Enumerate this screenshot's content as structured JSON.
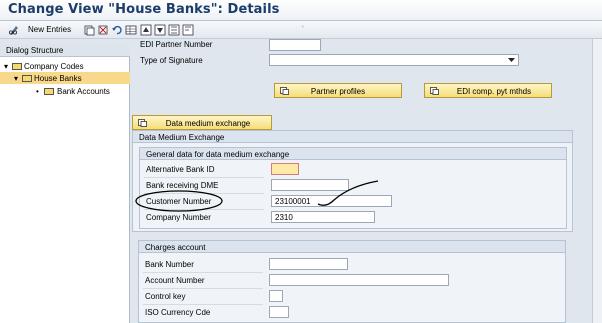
{
  "window": {
    "title": "Change View \"House Banks\": Details"
  },
  "toolbar": {
    "new_entries_label": "New Entries",
    "extra_mark": "ʼ"
  },
  "tree": {
    "header": "Dialog Structure",
    "items": [
      {
        "label": "Company Codes",
        "expander": "▾"
      },
      {
        "label": "House Banks",
        "expander": "▾"
      },
      {
        "label": "Bank Accounts",
        "expander": "•"
      }
    ]
  },
  "top_fields": {
    "edi_partner_label": "EDI Partner Number",
    "edi_partner_value": "",
    "signature_label": "Type of Signature",
    "signature_value": ""
  },
  "buttons": {
    "partner_profiles": "Partner profiles",
    "edi_comp": "EDI comp. pyt mthds",
    "dme": "Data medium exchange"
  },
  "dme_section": {
    "title": "Data Medium Exchange",
    "general_title": "General data for data medium exchange",
    "alt_bank_label": "Alternative Bank ID",
    "alt_bank_value": "",
    "bank_receiving_label": "Bank receiving DME",
    "bank_receiving_value": "",
    "customer_number_label": "Customer Number",
    "customer_number_value": "23100001",
    "company_number_label": "Company Number",
    "company_number_value": "2310"
  },
  "charges": {
    "title": "Charges account",
    "bank_number_label": "Bank Number",
    "bank_number_value": "",
    "account_number_label": "Account Number",
    "account_number_value": "",
    "control_key_label": "Control key",
    "control_key_value": "",
    "iso_label": "ISO Currency Cde",
    "iso_value": ""
  },
  "colors": {
    "title": "#1c3d6b",
    "button_fill": "#f6dd79",
    "selection": "#f8d88b",
    "annotation": "#000000"
  }
}
